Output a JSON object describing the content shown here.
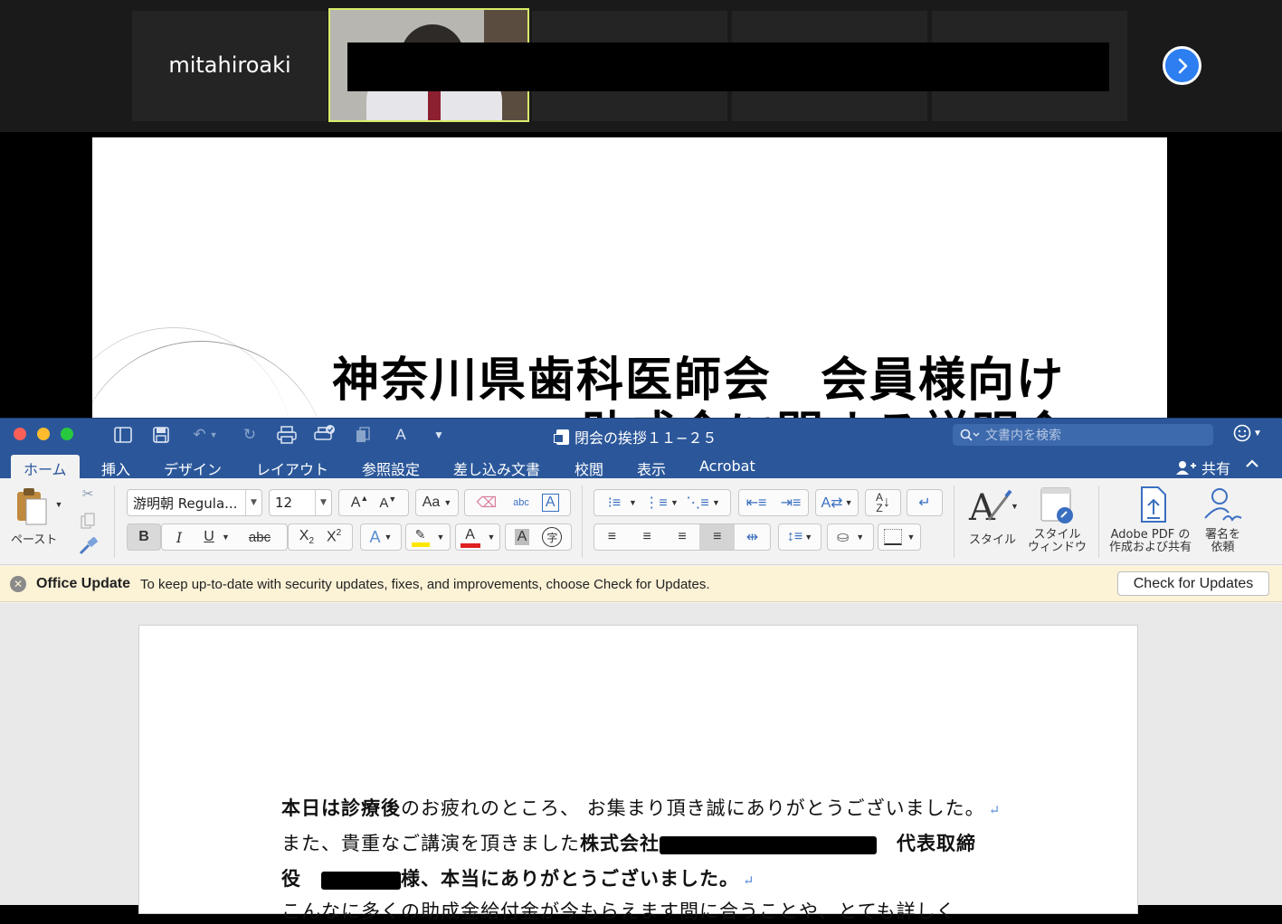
{
  "zoom": {
    "participant_name": "mitahiroaki",
    "next_icon": "chevron-right-icon"
  },
  "slide": {
    "title": "神奈川県歯科医師会　会員様向け",
    "subtitle": "助成金に関する説明会"
  },
  "word": {
    "document_title": "閉会の挨拶１１−２５",
    "search_placeholder": "文書内を検索",
    "tabs": [
      "ホーム",
      "挿入",
      "デザイン",
      "レイアウト",
      "参照設定",
      "差し込み文書",
      "校閲",
      "表示",
      "Acrobat"
    ],
    "share_label": "共有",
    "font_name": "游明朝 Regula...",
    "font_size": "12",
    "paste_label": "ペースト",
    "styles_label": "スタイル",
    "style_window_label_1": "スタイル",
    "style_window_label_2": "ウィンドウ",
    "adobe_label_1": "Adobe PDF の",
    "adobe_label_2": "作成および共有",
    "sign_label_1": "署名を",
    "sign_label_2": "依頼",
    "update": {
      "title": "Office Update",
      "message": "To keep up-to-date with security updates, fixes, and improvements, choose Check for Updates.",
      "button": "Check for Updates"
    },
    "document": {
      "line1_bold": "本日は診療後",
      "line1_rest": "のお疲れのところ、 お集まり頂き誠にありがとうございました。",
      "line2_start": "また、貴重なご講演を頂きました",
      "line2_bold": "株式会社",
      "line2_end": "代表取締",
      "line3_start": "役",
      "line3_end": "様、本当にありがとうございました。",
      "line4": "こんなに多くの助成金給付金が今もらえます間に合うことや、とても詳しく"
    }
  }
}
